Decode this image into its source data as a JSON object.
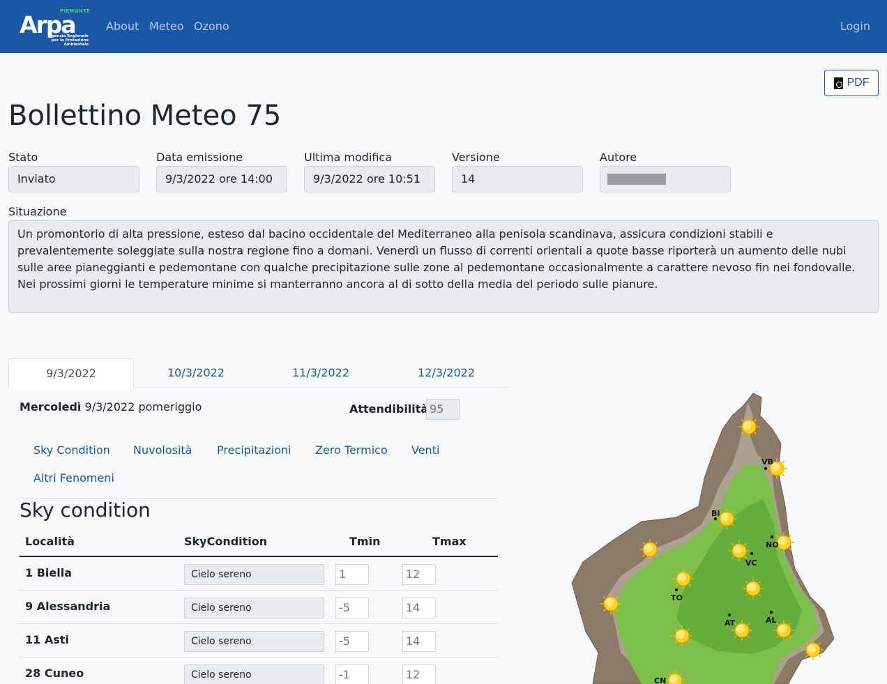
{
  "nav": {
    "logo_word": "Arpa",
    "logo_region": "PIEMONTE",
    "logo_agency_line1": "Agenzia Regionale",
    "logo_agency_line2": "per la Protezione Ambientale",
    "items": [
      {
        "label": "About"
      },
      {
        "label": "Meteo"
      },
      {
        "label": "Ozono"
      }
    ],
    "login_label": "Login"
  },
  "pdf_button_label": "PDF",
  "page_title": "Bollettino Meteo 75",
  "fields": {
    "stato": {
      "label": "Stato",
      "value": "Inviato"
    },
    "data_emissione": {
      "label": "Data emissione",
      "value": "9/3/2022 ore 14:00"
    },
    "ultima_modifica": {
      "label": "Ultima modifica",
      "value": "9/3/2022 ore 10:51"
    },
    "versione": {
      "label": "Versione",
      "value": "14"
    },
    "autore": {
      "label": "Autore",
      "value": ""
    }
  },
  "situazione": {
    "label": "Situazione",
    "text": "Un promontorio di alta pressione, esteso dal bacino occidentale del Mediterraneo alla penisola scandinava, assicura condizioni stabili e prevalentemente soleggiate sulla nostra regione fino a domani. Venerdì un flusso di correnti orientali a quote basse riporterà un aumento delle nubi sulle aree pianeggianti e pedemontane con qualche precipitazione sulle zone al pedemontane occasionalmente a carattere nevoso fin nei fondovalle. Nei prossimi giorni le temperature minime si manterranno ancora al di sotto della media del periodo sulle pianure."
  },
  "date_tabs": [
    {
      "label": "9/3/2022",
      "active": true
    },
    {
      "label": "10/3/2022",
      "active": false
    },
    {
      "label": "11/3/2022",
      "active": false
    },
    {
      "label": "12/3/2022",
      "active": false
    }
  ],
  "day": {
    "weekday": "Mercoledì",
    "rest": "9/3/2022 pomeriggio",
    "attendibilita_label": "Attendibilità:",
    "attendibilita_value": "95"
  },
  "sub_tabs": [
    {
      "label": "Sky Condition"
    },
    {
      "label": "Nuvolosità"
    },
    {
      "label": "Precipitazioni"
    },
    {
      "label": "Zero Termico"
    },
    {
      "label": "Venti"
    },
    {
      "label": "Altri Fenomeni"
    }
  ],
  "section_title": "Sky condition",
  "table": {
    "headers": {
      "localita": "Località",
      "sky": "SkyCondition",
      "tmin": "Tmin",
      "tmax": "Tmax"
    },
    "rows": [
      {
        "localita": "1 Biella",
        "sky": "Cielo sereno",
        "tmin": "1",
        "tmax": "12"
      },
      {
        "localita": "9 Alessandria",
        "sky": "Cielo sereno",
        "tmin": "-5",
        "tmax": "14"
      },
      {
        "localita": "11 Asti",
        "sky": "Cielo sereno",
        "tmin": "-5",
        "tmax": "14"
      },
      {
        "localita": "28 Cuneo",
        "sky": "Cielo sereno",
        "tmin": "-1",
        "tmax": "12"
      }
    ]
  },
  "map": {
    "city_labels": [
      "VB",
      "BI",
      "NO",
      "VC",
      "TO",
      "AT",
      "AL",
      "CN"
    ],
    "symbol": "sun-icon",
    "colors": {
      "plain": "#7cc04a",
      "hill": "#5ea93a",
      "mountain": "#8a7a66",
      "peak": "#c9bfb2"
    }
  },
  "colors": {
    "navbar": "#1a57a8",
    "link": "#1a57a8",
    "readonly": "#e9ecef"
  }
}
